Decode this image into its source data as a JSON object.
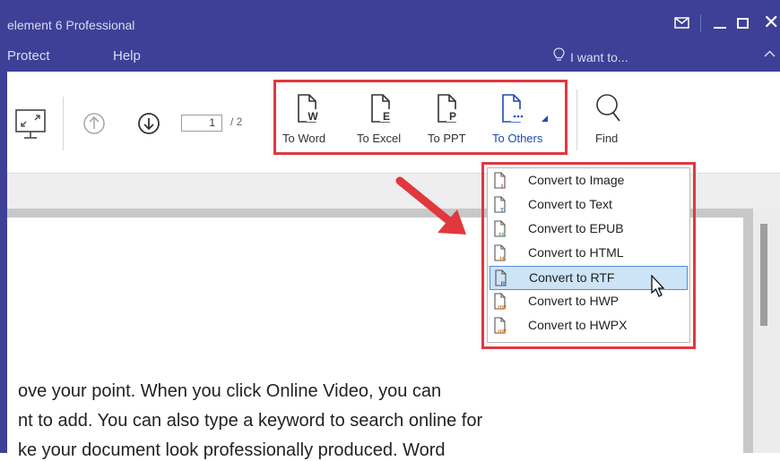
{
  "app": {
    "title": "element 6 Professional",
    "menu": [
      "Protect",
      "Help"
    ],
    "i_want_to": "I want to..."
  },
  "toolbar": {
    "page_current": "1",
    "page_total": "/ 2",
    "convert": {
      "to_word": "To Word",
      "to_excel": "To Excel",
      "to_ppt": "To PPT",
      "to_others": "To Others"
    },
    "find": "Find",
    "glyphs": {
      "word": "W",
      "excel": "E",
      "ppt": "P"
    }
  },
  "dropdown": {
    "items": [
      {
        "label": "Convert to Image",
        "tag": "I",
        "tag_color": "#c0392b"
      },
      {
        "label": "Convert to Text",
        "tag": "T",
        "tag_color": "#2e75b6"
      },
      {
        "label": "Convert to EPUB",
        "tag": "EP",
        "tag_color": "#4caf50"
      },
      {
        "label": "Convert to HTML",
        "tag": "H",
        "tag_color": "#e67e22"
      },
      {
        "label": "Convert to RTF",
        "tag": "R",
        "tag_color": "#2e75b6"
      },
      {
        "label": "Convert to HWP",
        "tag": "HW",
        "tag_color": "#e67e22"
      },
      {
        "label": "Convert to HWPX",
        "tag": "HW",
        "tag_color": "#e67e22"
      }
    ],
    "selected": "Convert to RTF"
  },
  "document": {
    "lines": [
      "ove your point. When you click Online Video, you can",
      "nt to add. You can also type a keyword to search online for",
      "ke your document look professionally produced. Word"
    ]
  },
  "colors": {
    "titlebar": "#3d4096",
    "accent_blue": "#1f4bb3",
    "highlight_red": "#e0383e",
    "selection": "#cde3f6"
  }
}
